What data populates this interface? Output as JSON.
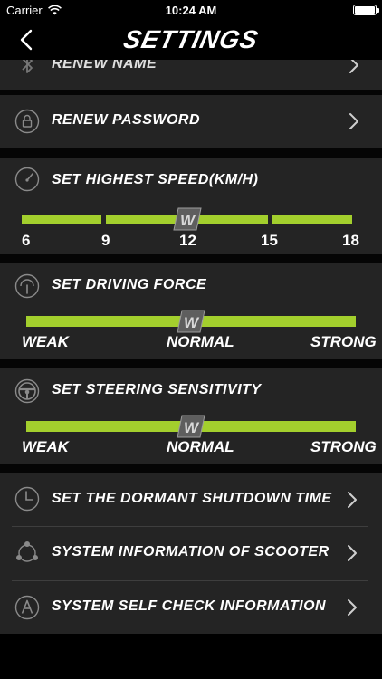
{
  "status": {
    "carrier": "Carrier",
    "time": "10:24 AM"
  },
  "nav": {
    "title": "SETTINGS"
  },
  "rows": {
    "renew_name": "RENEW NAME",
    "renew_password": "RENEW PASSWORD",
    "highest_speed": "SET HIGHEST SPEED(KM/H)",
    "driving_force": "SET DRIVING FORCE",
    "steering": "SET STEERING SENSITIVITY",
    "dormant": "SET THE DORMANT SHUTDOWN TIME",
    "system_info": "SYSTEM INFORMATION OF SCOOTER",
    "self_check": "SYSTEM SELF CHECK INFORMATION"
  },
  "speed": {
    "ticks": [
      "6",
      "9",
      "12",
      "15",
      "18"
    ],
    "value": 12
  },
  "force": {
    "labels": [
      "WEAK",
      "NORMAL",
      "STRONG"
    ],
    "value": "NORMAL"
  },
  "steer": {
    "labels": [
      "WEAK",
      "NORMAL",
      "STRONG"
    ],
    "value": "NORMAL"
  },
  "slider_knob_letter": "W",
  "colors": {
    "accent": "#a3cf2d",
    "card": "#242424",
    "background": "#000000"
  }
}
